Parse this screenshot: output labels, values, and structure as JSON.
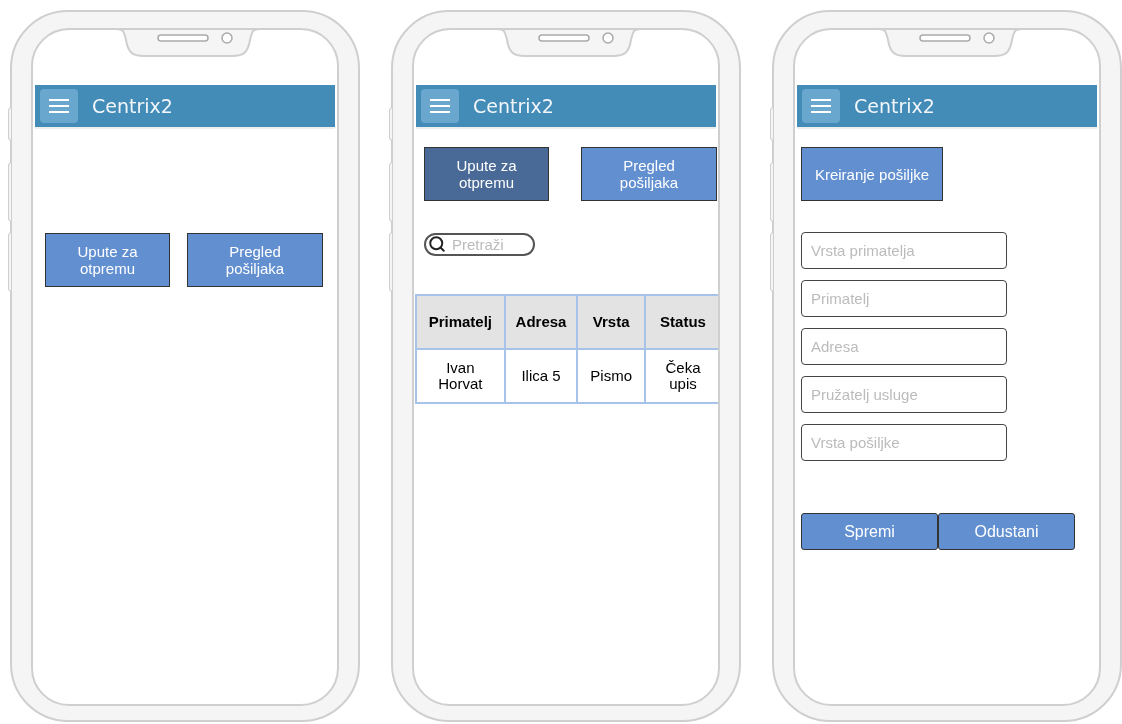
{
  "screens": [
    {
      "kind": "home",
      "header": {
        "title": "Centrix2"
      },
      "buttons": [
        {
          "label": "Upute za otpremu",
          "selected": false
        },
        {
          "label": "Pregled pošiljaka",
          "selected": false
        }
      ]
    },
    {
      "kind": "list",
      "header": {
        "title": "Centrix2"
      },
      "buttons": [
        {
          "label": "Upute za otpremu",
          "selected": true
        },
        {
          "label": "Pregled pošiljaka",
          "selected": false
        }
      ],
      "search": {
        "placeholder": "Pretraži"
      },
      "table": {
        "columns": [
          "Primatelj",
          "Adresa",
          "Vrsta",
          "Status"
        ],
        "rows": [
          [
            "Ivan Horvat",
            "Ilica 5",
            "Pismo",
            "Čeka upis"
          ]
        ]
      }
    },
    {
      "kind": "form",
      "header": {
        "title": "Centrix2"
      },
      "buttons": [
        {
          "label": "Kreiranje pošiljke",
          "selected": false
        }
      ],
      "fields": [
        {
          "placeholder": "Vrsta primatelja"
        },
        {
          "placeholder": "Primatelj"
        },
        {
          "placeholder": "Adresa"
        },
        {
          "placeholder": "Pružatelj usluge"
        },
        {
          "placeholder": "Vrsta pošiljke"
        }
      ],
      "actions": [
        "Spremi",
        "Odustani"
      ]
    }
  ]
}
